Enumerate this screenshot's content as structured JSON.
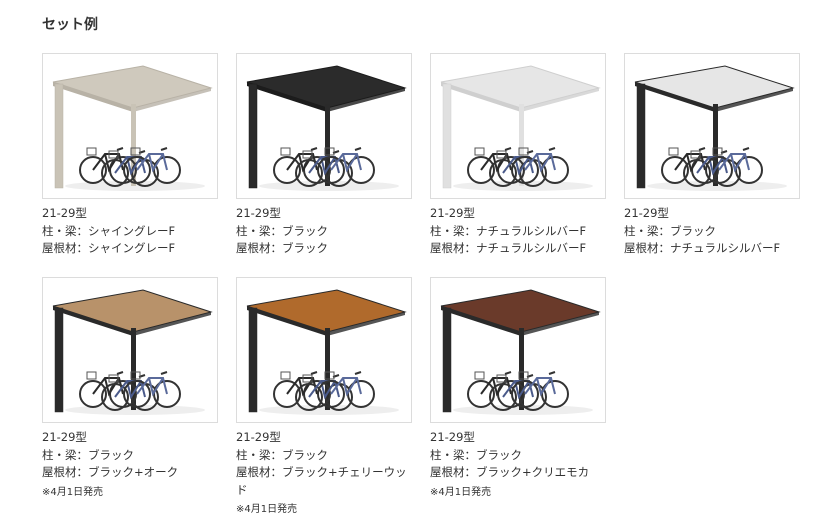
{
  "section_title": "セット例",
  "colors": {
    "shining_grey": "#cfc9bd",
    "black": "#2b2b2b",
    "natural_silver": "#e6e6e6",
    "oak": "#b8926a",
    "cherry": "#b06a2c",
    "kuriemoca": "#6a3a2a",
    "frame_black": "#2a2a2a",
    "frame_grey": "#c9c3b6",
    "frame_silver": "#e0e0e0"
  },
  "items": [
    {
      "model": "21-29型",
      "pillar": "柱・梁：シャイングレーF",
      "roof": "屋根材：シャイングレーF",
      "note": "",
      "image": "carport-shining-grey"
    },
    {
      "model": "21-29型",
      "pillar": "柱・梁：ブラック",
      "roof": "屋根材：ブラック",
      "note": "",
      "image": "carport-black"
    },
    {
      "model": "21-29型",
      "pillar": "柱・梁：ナチュラルシルバーF",
      "roof": "屋根材：ナチュラルシルバーF",
      "note": "",
      "image": "carport-natural-silver"
    },
    {
      "model": "21-29型",
      "pillar": "柱・梁：ブラック",
      "roof": "屋根材：ナチュラルシルバーF",
      "note": "",
      "image": "carport-black-silver"
    },
    {
      "model": "21-29型",
      "pillar": "柱・梁：ブラック",
      "roof": "屋根材：ブラック+オーク",
      "note": "※4月1日発売",
      "image": "carport-black-oak"
    },
    {
      "model": "21-29型",
      "pillar": "柱・梁：ブラック",
      "roof": "屋根材：ブラック+チェリーウッド",
      "note": "※4月1日発売",
      "image": "carport-black-cherry"
    },
    {
      "model": "21-29型",
      "pillar": "柱・梁：ブラック",
      "roof": "屋根材：ブラック+クリエモカ",
      "note": "※4月1日発売",
      "image": "carport-black-kuriemoca"
    }
  ]
}
